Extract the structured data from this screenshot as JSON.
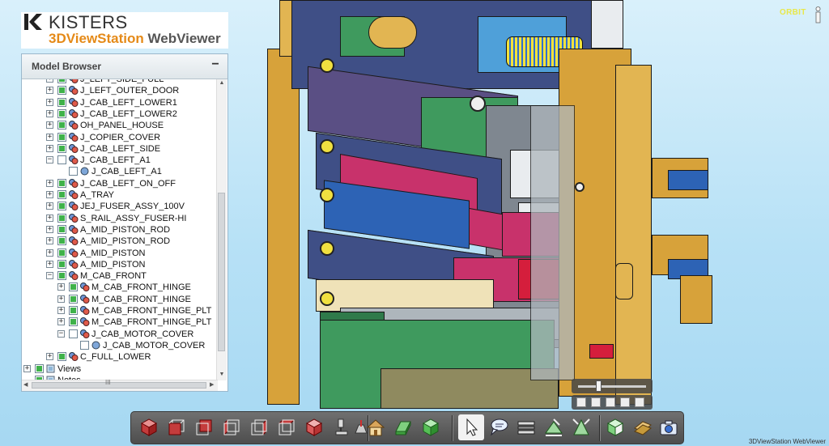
{
  "app": {
    "brand": "KISTERS",
    "product_name": "3DViewStation",
    "product_suffix": " WebViewer",
    "footer": "3DViewStation WebViewer"
  },
  "view": {
    "mode_label": "ORBIT",
    "info_icon": "info-icon"
  },
  "model_browser": {
    "title": "Model Browser",
    "collapse_glyph": "−",
    "items": [
      {
        "label": "J_LEFT_SIDE_FULL",
        "level": 1,
        "expander": "+",
        "checked": true
      },
      {
        "label": "J_LEFT_OUTER_DOOR",
        "level": 1,
        "expander": "+",
        "checked": true
      },
      {
        "label": "J_CAB_LEFT_LOWER1",
        "level": 1,
        "expander": "+",
        "checked": true
      },
      {
        "label": "J_CAB_LEFT_LOWER2",
        "level": 1,
        "expander": "+",
        "checked": true
      },
      {
        "label": "OH_PANEL_HOUSE",
        "level": 1,
        "expander": "+",
        "checked": true
      },
      {
        "label": "J_COPIER_COVER",
        "level": 1,
        "expander": "+",
        "checked": true
      },
      {
        "label": "J_CAB_LEFT_SIDE",
        "level": 1,
        "expander": "+",
        "checked": true
      },
      {
        "label": "J_CAB_LEFT_A1",
        "level": 1,
        "expander": "−",
        "checked": false
      },
      {
        "label": "J_CAB_LEFT_A1",
        "level": 2,
        "expander": "",
        "checked": false
      },
      {
        "label": "J_CAB_LEFT_ON_OFF",
        "level": 1,
        "expander": "+",
        "checked": true
      },
      {
        "label": "A_TRAY",
        "level": 1,
        "expander": "+",
        "checked": true
      },
      {
        "label": "JEJ_FUSER_ASSY_100V",
        "level": 1,
        "expander": "+",
        "checked": true
      },
      {
        "label": "S_RAIL_ASSY_FUSER-HI",
        "level": 1,
        "expander": "+",
        "checked": true
      },
      {
        "label": "A_MID_PISTON_ROD",
        "level": 1,
        "expander": "+",
        "checked": true
      },
      {
        "label": "A_MID_PISTON_ROD",
        "level": 1,
        "expander": "+",
        "checked": true
      },
      {
        "label": "A_MID_PISTON",
        "level": 1,
        "expander": "+",
        "checked": true
      },
      {
        "label": "A_MID_PISTON",
        "level": 1,
        "expander": "+",
        "checked": true
      },
      {
        "label": "M_CAB_FRONT",
        "level": 1,
        "expander": "−",
        "checked": true
      },
      {
        "label": "M_CAB_FRONT_HINGE",
        "level": 2,
        "expander": "+",
        "checked": true
      },
      {
        "label": "M_CAB_FRONT_HINGE",
        "level": 2,
        "expander": "+",
        "checked": true
      },
      {
        "label": "M_CAB_FRONT_HINGE_PLT",
        "level": 2,
        "expander": "+",
        "checked": true
      },
      {
        "label": "M_CAB_FRONT_HINGE_PLT",
        "level": 2,
        "expander": "+",
        "checked": true
      },
      {
        "label": "J_CAB_MOTOR_COVER",
        "level": 2,
        "expander": "−",
        "checked": false
      },
      {
        "label": "J_CAB_MOTOR_COVER",
        "level": 3,
        "expander": "",
        "checked": false
      },
      {
        "label": "C_FULL_LOWER",
        "level": 1,
        "expander": "+",
        "checked": true
      },
      {
        "label": "Views",
        "level": 0,
        "expander": "+",
        "checked": true
      },
      {
        "label": "Notes",
        "level": 0,
        "expander": "",
        "checked": true
      }
    ],
    "scroll_grip": "III"
  },
  "zoom": {
    "level": 0.3
  },
  "toolbar": {
    "buttons": [
      {
        "name": "view-iso-button",
        "icon": "cube-solid-icon"
      },
      {
        "name": "view-front-button",
        "icon": "cube-front-icon"
      },
      {
        "name": "view-back-button",
        "icon": "cube-back-icon"
      },
      {
        "name": "view-left-button",
        "icon": "cube-left-icon"
      },
      {
        "name": "view-right-button",
        "icon": "cube-right-icon"
      },
      {
        "name": "view-top-button",
        "icon": "cube-top-icon"
      },
      {
        "name": "view-bottom-button",
        "icon": "cube-bottom-icon"
      },
      {
        "name": "microscope-button",
        "icon": "microscope-icon"
      },
      {
        "name": "pointer-tool-button",
        "icon": "hand-pointer-icon"
      },
      {
        "name": "home-view-button",
        "icon": "home-icon"
      },
      {
        "name": "fit-all-button",
        "icon": "green-box-icon"
      },
      {
        "name": "render-mode-button",
        "icon": "green-cube-icon"
      },
      {
        "name": "select-button",
        "icon": "arrow-cursor-icon"
      },
      {
        "name": "annotation-button",
        "icon": "speech-bubble-icon"
      },
      {
        "name": "section-button",
        "icon": "section-plane-icon"
      },
      {
        "name": "measure-button",
        "icon": "measure-icon"
      },
      {
        "name": "explode-button",
        "icon": "explode-icon"
      },
      {
        "name": "wall-thickness-button",
        "icon": "wall-icon"
      },
      {
        "name": "compare-button",
        "icon": "compare-icon"
      },
      {
        "name": "snapshot-button",
        "icon": "camera-icon"
      }
    ]
  }
}
